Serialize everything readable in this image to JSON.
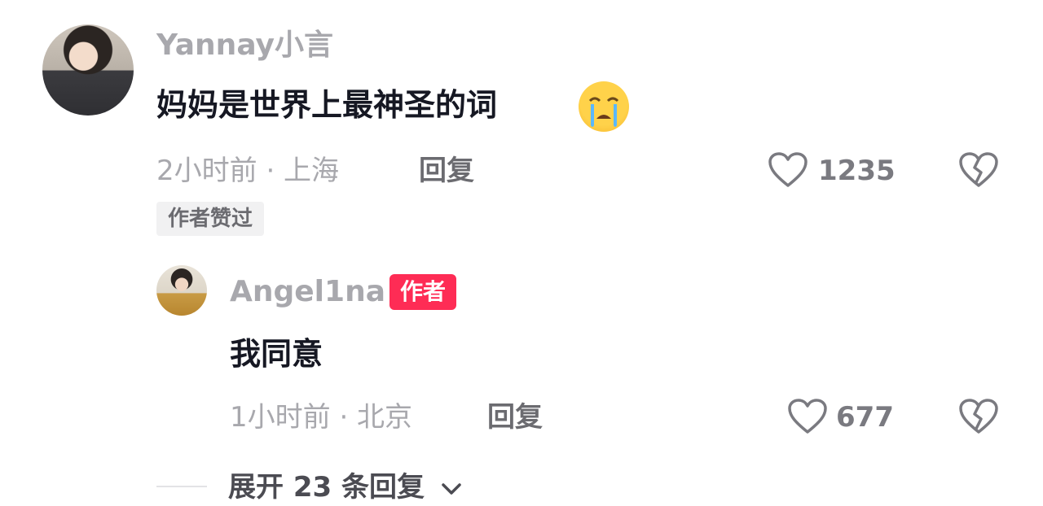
{
  "comment": {
    "username": "Yannay小言",
    "text": "妈妈是世界上最神圣的词",
    "emoji": "loudly-crying-face",
    "time_location": "2小时前 · 上海",
    "reply_label": "回复",
    "likes": "1235",
    "liked_by_author_badge": "作者赞过",
    "avatar": "child-photo-avatar",
    "like_icon": "heart-outline-icon",
    "dislike_icon": "broken-heart-icon"
  },
  "reply": {
    "username": "Angel1na",
    "author_badge": "作者",
    "text": "我同意",
    "time_location": "1小时前 · 北京",
    "reply_label": "回复",
    "likes": "677",
    "avatar": "child-photo-avatar",
    "like_icon": "heart-outline-icon",
    "dislike_icon": "broken-heart-icon"
  },
  "expand_replies": {
    "label": "展开 23 条回复",
    "icon": "chevron-down-icon"
  },
  "colors": {
    "author_badge_bg": "#fe2c55",
    "muted_text": "#a8a8ad",
    "primary_text": "#161823"
  }
}
